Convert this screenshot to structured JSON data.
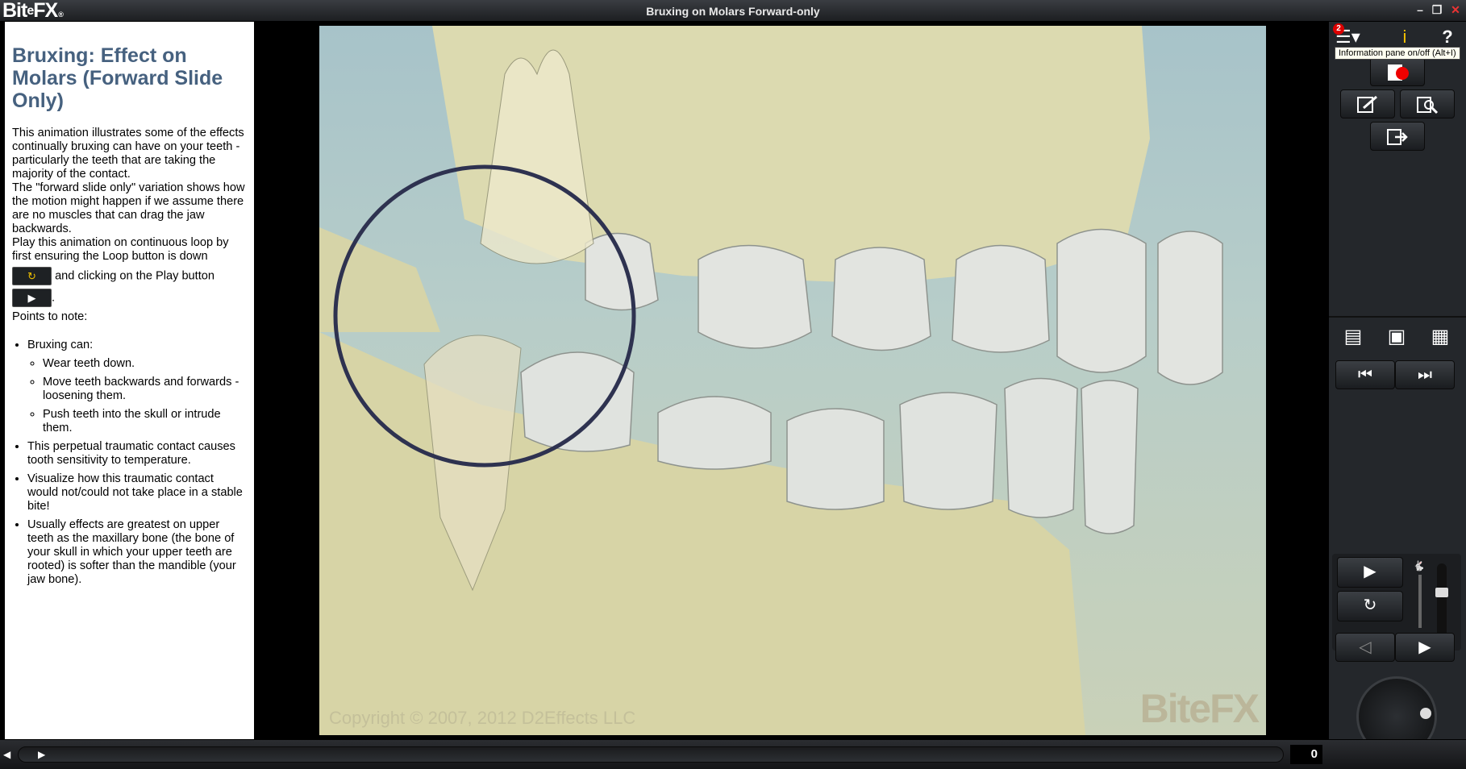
{
  "titlebar": {
    "logo_text": "BiteFX",
    "window_title": "Bruxing on Molars Forward-only",
    "minimize_glyph": "–",
    "restore_glyph": "❐",
    "close_glyph": "✕"
  },
  "info": {
    "title": "Bruxing: Effect on Molars (Forward Slide Only)",
    "intro": "This animation illustrates some of the effects continually bruxing can have on your teeth - particularly the teeth that are taking the majority of the contact.",
    "variation": "The \"forward slide only\" variation shows how the motion might happen if we assume there are no muscles that can drag the jaw backwards.",
    "play_instructions": "Play this animation on continuous loop by first ensuring the Loop button is down",
    "and_clicking": "and clicking on the Play button",
    "period": ".",
    "points_label": "Points to note:",
    "bullets": [
      "Bruxing can:",
      "This perpetual traumatic contact causes tooth sensitivity to temperature.",
      "Visualize how this traumatic contact would not/could not take place in a stable bite!",
      "Usually effects are greatest on upper teeth as the maxillary bone (the bone of your skull in which your upper teeth are rooted) is softer than the mandible (your jaw bone)."
    ],
    "sub_bullets": [
      "Wear teeth down.",
      "Move teeth backwards and forwards - loosening them.",
      "Push teeth into the skull or intrude them."
    ]
  },
  "viewport": {
    "copyright": "Copyright © 2007, 2012 D2Effects LLC",
    "watermark": "BiteFX"
  },
  "panel": {
    "menu_badge": "2",
    "help_label": "?",
    "tooltip": "Information pane on/off (Alt+I)"
  },
  "bottombar": {
    "frame_counter": "0"
  },
  "colors": {
    "title_blue": "#46617f",
    "panel_bg": "#24272b",
    "bone": "#d9d8ad",
    "tooth": "#e4e6e2",
    "circle": "#2e3250"
  }
}
